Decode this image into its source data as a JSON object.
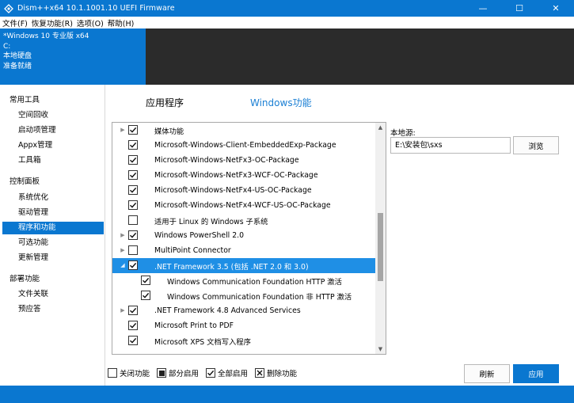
{
  "window": {
    "title": "Dism++x64 10.1.1001.10 UEFI Firmware",
    "icon": "dism-app-icon",
    "controls": {
      "minimize": "—",
      "maximize": "☐",
      "close": "✕"
    }
  },
  "menu": [
    "文件(F)",
    "恢复功能(R)",
    "选项(O)",
    "帮助(H)"
  ],
  "header": {
    "lines": [
      "*Windows 10 专业版 x64",
      "C:",
      "本地硬盘",
      "准备就绪"
    ]
  },
  "sidebar": {
    "groups": [
      {
        "label": "常用工具",
        "items": [
          "空间回收",
          "启动项管理",
          "Appx管理",
          "工具箱"
        ]
      },
      {
        "label": "控制面板",
        "items": [
          "系统优化",
          "驱动管理",
          "程序和功能",
          "可选功能",
          "更新管理"
        ]
      },
      {
        "label": "部署功能",
        "items": [
          "文件关联",
          "预应答"
        ]
      }
    ],
    "active": "程序和功能"
  },
  "tabs": [
    "应用程序",
    "Windows功能"
  ],
  "features": [
    {
      "label": "媒体功能",
      "level": 0,
      "expandable": true,
      "state": "checked"
    },
    {
      "label": "Microsoft-Windows-Client-EmbeddedExp-Package",
      "level": 0,
      "expandable": false,
      "state": "checked"
    },
    {
      "label": "Microsoft-Windows-NetFx3-OC-Package",
      "level": 0,
      "expandable": false,
      "state": "checked"
    },
    {
      "label": "Microsoft-Windows-NetFx3-WCF-OC-Package",
      "level": 0,
      "expandable": false,
      "state": "checked"
    },
    {
      "label": "Microsoft-Windows-NetFx4-US-OC-Package",
      "level": 0,
      "expandable": false,
      "state": "checked"
    },
    {
      "label": "Microsoft-Windows-NetFx4-WCF-US-OC-Package",
      "level": 0,
      "expandable": false,
      "state": "checked"
    },
    {
      "label": "适用于 Linux 的 Windows 子系统",
      "level": 0,
      "expandable": false,
      "state": "unchecked"
    },
    {
      "label": "Windows PowerShell 2.0",
      "level": 0,
      "expandable": true,
      "state": "checked"
    },
    {
      "label": "MultiPoint Connector",
      "level": 0,
      "expandable": true,
      "state": "unchecked"
    },
    {
      "label": ".NET Framework 3.5 (包括 .NET 2.0 和 3.0)",
      "level": 0,
      "expandable": true,
      "expanded": true,
      "state": "checked",
      "selected": true
    },
    {
      "label": "Windows Communication Foundation HTTP 激活",
      "level": 1,
      "expandable": false,
      "state": "checked"
    },
    {
      "label": "Windows Communication Foundation 非 HTTP 激活",
      "level": 1,
      "expandable": false,
      "state": "checked"
    },
    {
      "label": ".NET Framework 4.8 Advanced Services",
      "level": 0,
      "expandable": true,
      "state": "checked"
    },
    {
      "label": "Microsoft Print to PDF",
      "level": 0,
      "expandable": false,
      "state": "checked"
    },
    {
      "label": "Microsoft XPS 文档写入程序",
      "level": 0,
      "expandable": false,
      "state": "checked"
    }
  ],
  "source": {
    "label": "本地源:",
    "value": "E:\\安装包\\sxs",
    "browse": "浏览"
  },
  "legend": [
    {
      "label": "关闭功能",
      "state": "unchecked"
    },
    {
      "label": "部分启用",
      "state": "partial"
    },
    {
      "label": "全部启用",
      "state": "checked"
    },
    {
      "label": "删除功能",
      "state": "removed"
    }
  ],
  "buttons": {
    "refresh": "刷新",
    "apply": "应用"
  },
  "colors": {
    "accent": "#0a77d0",
    "selection": "#1f8fe5",
    "header_dark": "#2b2b2b"
  }
}
